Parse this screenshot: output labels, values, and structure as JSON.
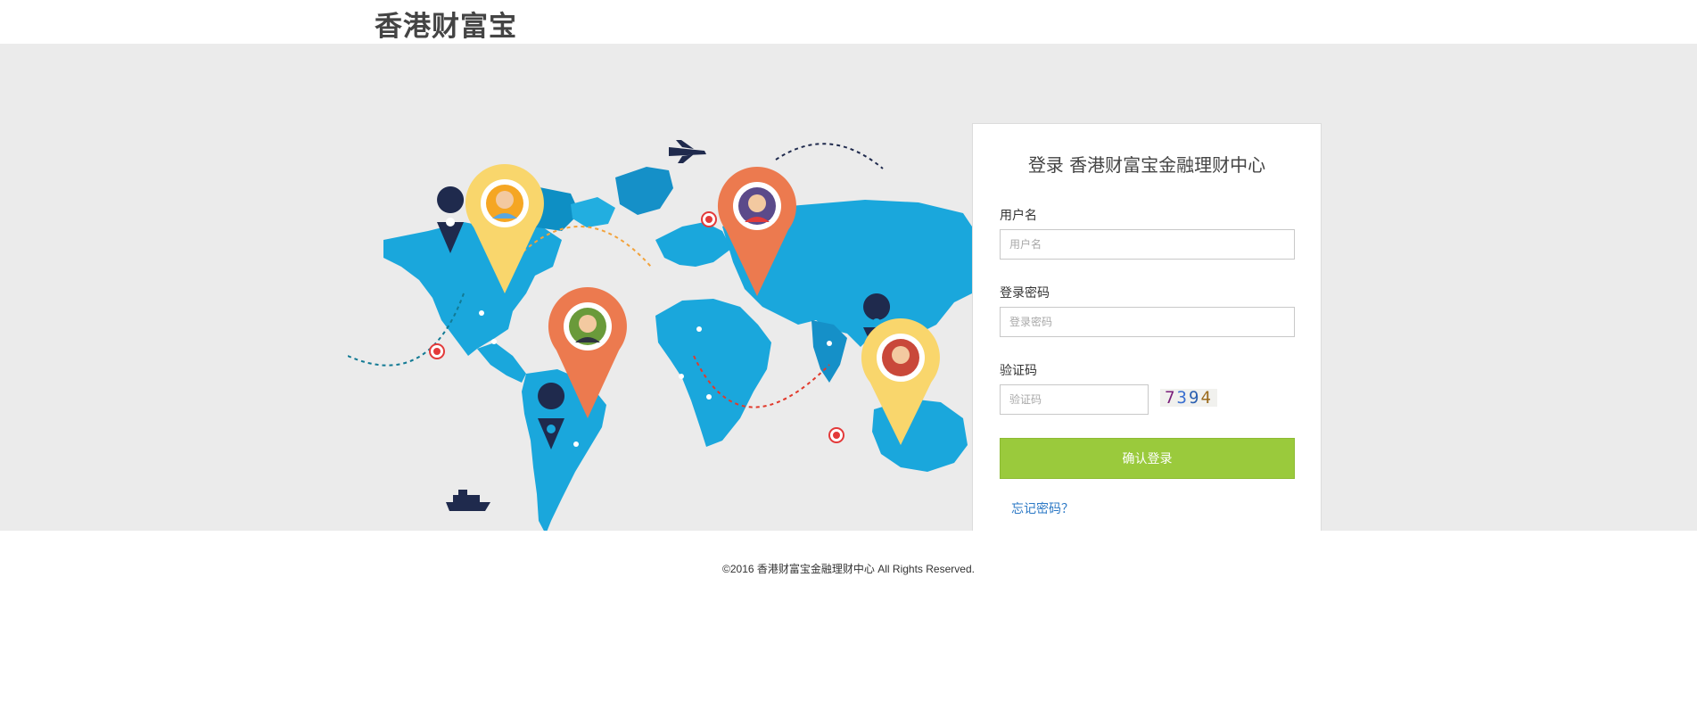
{
  "header": {
    "brand": "香港财富宝"
  },
  "login": {
    "title": "登录 香港财富宝金融理财中心",
    "username_label": "用户名",
    "username_placeholder": "用户名",
    "username_value": "",
    "password_label": "登录密码",
    "password_placeholder": "登录密码",
    "password_value": "",
    "captcha_label": "验证码",
    "captcha_placeholder": "验证码",
    "captcha_value": "",
    "captcha_chars": [
      "7",
      "3",
      "9",
      "4"
    ],
    "submit_label": "确认登录",
    "forgot_label": "忘记密码？"
  },
  "footer": {
    "copyright": "©2016 香港财富宝金融理财中心 All Rights Reserved."
  },
  "colors": {
    "band_bg": "#ebebeb",
    "map_blue": "#1aa7dc",
    "pin_yellow": "#f9d66c",
    "pin_orange": "#ec7a4f",
    "pin_navy": "#1f2a4d",
    "submit_green": "#9aca3c",
    "link_blue": "#2b78c5"
  },
  "illustration": {
    "icons": [
      "airplane-icon",
      "ship-icon",
      "location-pin-icon",
      "person-avatar-icon",
      "target-marker-icon"
    ]
  }
}
